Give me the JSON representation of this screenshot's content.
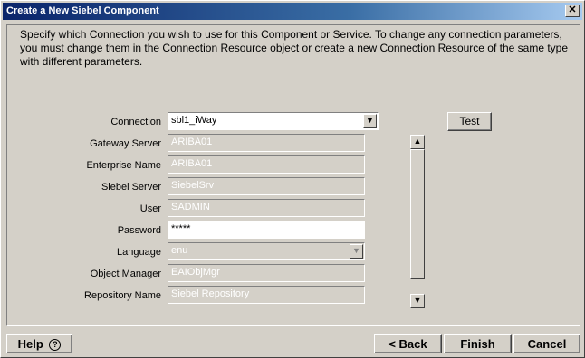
{
  "window": {
    "title": "Create a New Siebel Component",
    "close_glyph": "✕"
  },
  "instructions": "Specify which Connection you wish to use for this Component or Service.  To change any connection parameters, you must change them in the Connection Resource object or create a new Connection Resource of the same type with different parameters.",
  "form": {
    "connection": {
      "label": "Connection",
      "value": "sbl1_iWay"
    },
    "test_label": "Test",
    "fields": [
      {
        "label": "Gateway Server",
        "value": "ARIBA01"
      },
      {
        "label": "Enterprise Name",
        "value": "ARIBA01"
      },
      {
        "label": "Siebel Server",
        "value": "SiebelSrv"
      },
      {
        "label": "User",
        "value": "SADMIN"
      },
      {
        "label": "Password",
        "value": "*****"
      },
      {
        "label": "Language",
        "value": "enu"
      },
      {
        "label": "Object Manager",
        "value": "EAIObjMgr"
      },
      {
        "label": "Repository Name",
        "value": "Siebel Repository"
      }
    ]
  },
  "footer": {
    "help_label": "Help",
    "help_icon_glyph": "?",
    "back_label": "< Back",
    "finish_label": "Finish",
    "cancel_label": "Cancel"
  },
  "icons": {
    "dropdown_arrow": "chevron-down-icon",
    "scroll_up": "arrow-up-icon",
    "scroll_down": "arrow-down-icon",
    "help": "help-circle-icon",
    "close": "close-icon"
  },
  "colors": {
    "title_gradient_start": "#0a246a",
    "title_gradient_end": "#a6caf0",
    "face": "#d4d0c8"
  }
}
